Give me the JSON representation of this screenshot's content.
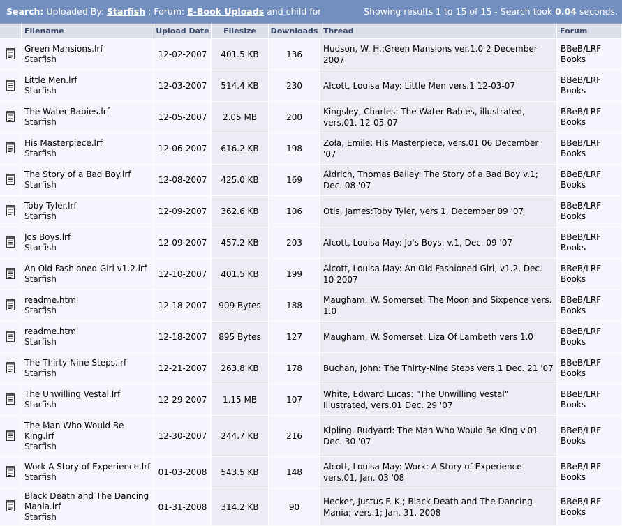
{
  "search_bar": {
    "prefix": "Search:",
    "uploaded_by_label": "Uploaded By:",
    "user": "Starfish",
    "forum_label": "; Forum:",
    "forum": "E-Book Uploads",
    "suffix": "and child forums",
    "results_text": "Showing results 1 to 15 of 15 - Search took",
    "time": "0.04",
    "time_unit": "seconds."
  },
  "columns": {
    "filename": "Filename",
    "upload_date": "Upload Date",
    "filesize": "Filesize",
    "downloads": "Downloads",
    "thread": "Thread",
    "forum": "Forum"
  },
  "rows": [
    {
      "file": "Green Mansions.lrf",
      "user": "Starfish",
      "date": "12-02-2007",
      "size": "401.5 KB",
      "downloads": "136",
      "thread": "Hudson, W. H.:Green Mansions ver.1.0 2 December 2007",
      "forum1": "BBeB/LRF",
      "forum2": "Books"
    },
    {
      "file": "Little Men.lrf",
      "user": "Starfish",
      "date": "12-03-2007",
      "size": "514.4 KB",
      "downloads": "230",
      "thread": "Alcott, Louisa May: Little Men vers.1 12-03-07",
      "forum1": "BBeB/LRF",
      "forum2": "Books"
    },
    {
      "file": "The Water Babies.lrf",
      "user": "Starfish",
      "date": "12-05-2007",
      "size": "2.05 MB",
      "downloads": "200",
      "thread": "Kingsley, Charles: The Water Babies, illustrated, vers.01. 12-05-07",
      "forum1": "BBeB/LRF",
      "forum2": "Books"
    },
    {
      "file": "His Masterpiece.lrf",
      "user": "Starfish",
      "date": "12-06-2007",
      "size": "616.2 KB",
      "downloads": "198",
      "thread": "Zola, Emile: His Masterpiece, vers.01 06 December '07",
      "forum1": "BBeB/LRF",
      "forum2": "Books"
    },
    {
      "file": "The Story of a Bad Boy.lrf",
      "user": "Starfish",
      "date": "12-08-2007",
      "size": "425.0 KB",
      "downloads": "169",
      "thread": "Aldrich, Thomas Bailey: The Story of a Bad Boy v.1; Dec. 08 '07",
      "forum1": "BBeB/LRF",
      "forum2": "Books"
    },
    {
      "file": "Toby Tyler.lrf",
      "user": "Starfish",
      "date": "12-09-2007",
      "size": "362.6 KB",
      "downloads": "106",
      "thread": "Otis, James:Toby Tyler, vers 1, December 09 '07",
      "forum1": "BBeB/LRF",
      "forum2": "Books"
    },
    {
      "file": "Jos Boys.lrf",
      "user": "Starfish",
      "date": "12-09-2007",
      "size": "457.2 KB",
      "downloads": "203",
      "thread": "Alcott, Louisa May: Jo's Boys, v.1, Dec. 09 '07",
      "forum1": "BBeB/LRF",
      "forum2": "Books"
    },
    {
      "file": "An Old Fashioned Girl v1.2.lrf",
      "user": "Starfish",
      "date": "12-10-2007",
      "size": "401.5 KB",
      "downloads": "199",
      "thread": "Alcott, Louisa May: An Old Fashioned Girl, v1.2, Dec. 10 2007",
      "forum1": "BBeB/LRF",
      "forum2": "Books"
    },
    {
      "file": "readme.html",
      "user": "Starfish",
      "date": "12-18-2007",
      "size": "909 Bytes",
      "downloads": "188",
      "thread": "Maugham, W. Somerset: The Moon and Sixpence vers. 1.0",
      "forum1": "BBeB/LRF",
      "forum2": "Books"
    },
    {
      "file": "readme.html",
      "user": "Starfish",
      "date": "12-18-2007",
      "size": "895 Bytes",
      "downloads": "127",
      "thread": "Maugham, W. Somerset: Liza Of Lambeth vers 1.0",
      "forum1": "BBeB/LRF",
      "forum2": "Books"
    },
    {
      "file": "The Thirty-Nine Steps.lrf",
      "user": "Starfish",
      "date": "12-21-2007",
      "size": "263.8 KB",
      "downloads": "178",
      "thread": "Buchan, John: The Thirty-Nine Steps vers.1 Dec. 21 '07",
      "forum1": "BBeB/LRF",
      "forum2": "Books"
    },
    {
      "file": "The Unwilling Vestal.lrf",
      "user": "Starfish",
      "date": "12-29-2007",
      "size": "1.15 MB",
      "downloads": "107",
      "thread": "White, Edward Lucas: \"The Unwilling Vestal\" Illustrated, vers.01 Dec. 29 '07",
      "forum1": "BBeB/LRF",
      "forum2": "Books"
    },
    {
      "file": "The Man Who Would Be King.lrf",
      "user": "Starfish",
      "date": "12-30-2007",
      "size": "244.7 KB",
      "downloads": "216",
      "thread": "Kipling, Rudyard: The Man Who Would Be King v.01 Dec. 30 '07",
      "forum1": "BBeB/LRF",
      "forum2": "Books"
    },
    {
      "file": "Work A Story of Experience.lrf",
      "user": "Starfish",
      "date": "01-03-2008",
      "size": "543.5 KB",
      "downloads": "148",
      "thread": "Alcott, Louisa May: Work: A Story of Experience vers.01, Jan. 03 '08",
      "forum1": "BBeB/LRF",
      "forum2": "Books"
    },
    {
      "file": "Black Death and The Dancing Mania.lrf",
      "user": "Starfish",
      "date": "01-31-2008",
      "size": "314.2 KB",
      "downloads": "90",
      "thread": "Hecker, Justus F. K.; Black Death and The Dancing Mania; vers.1; Jan. 31, 2008",
      "forum1": "BBeB/LRF",
      "forum2": "Books"
    }
  ]
}
